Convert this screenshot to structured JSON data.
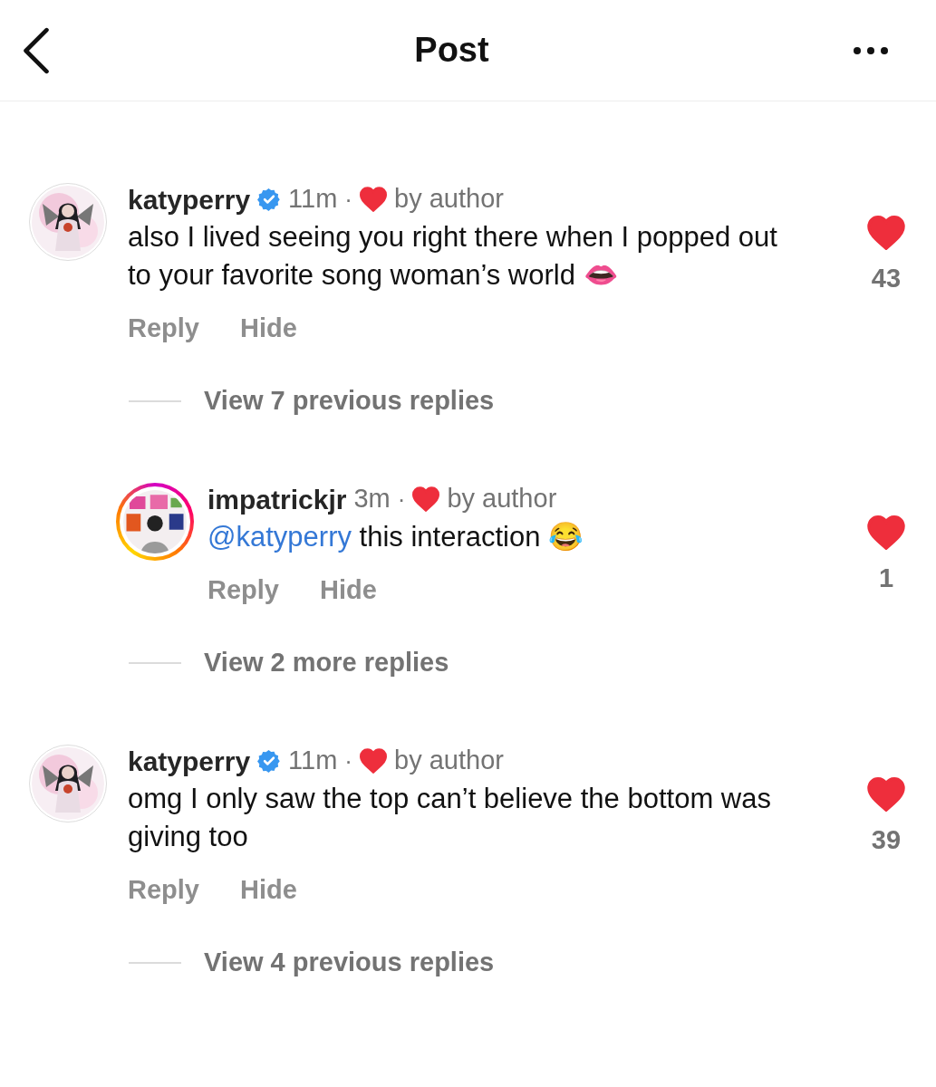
{
  "header": {
    "title": "Post"
  },
  "threads": [
    {
      "comment": {
        "username": "katyperry",
        "verified": true,
        "story_ring": false,
        "time": "11m",
        "dot": "·",
        "liked_by_author": true,
        "author_label": "by author",
        "text": "also I lived seeing you right there when I popped out to your favorite song woman’s world 👄",
        "liked": true,
        "likes": "43",
        "actions": [
          "Reply",
          "Hide"
        ]
      },
      "replies_link": "View 7 previous replies",
      "replies": [
        {
          "username": "impatrickjr",
          "verified": false,
          "story_ring": true,
          "time": "3m",
          "dot": "·",
          "liked_by_author": true,
          "author_label": "by author",
          "mention": "@katyperry",
          "text": "this interaction 😂",
          "liked": true,
          "likes": "1",
          "actions": [
            "Reply",
            "Hide"
          ]
        }
      ],
      "more_link": "View 2 more replies"
    },
    {
      "comment": {
        "username": "katyperry",
        "verified": true,
        "story_ring": false,
        "time": "11m",
        "dot": "·",
        "liked_by_author": true,
        "author_label": "by author",
        "text": "omg I only saw the top can’t believe the bottom was giving too",
        "liked": true,
        "likes": "39",
        "actions": [
          "Reply",
          "Hide"
        ]
      },
      "replies_link": "View 4 previous replies"
    }
  ]
}
